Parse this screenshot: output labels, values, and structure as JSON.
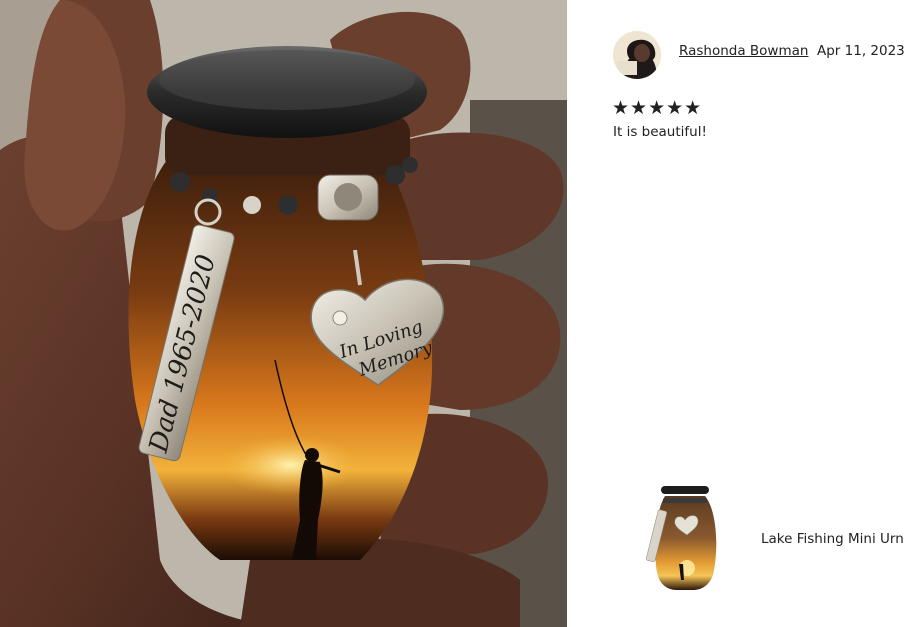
{
  "review": {
    "reviewer_name": "Rashonda Bowman",
    "date": "Apr 11, 2023",
    "rating": 5,
    "stars_text": "★★★★★",
    "text": "It is beautiful!"
  },
  "product": {
    "name": "Lake Fishing Mini Urn"
  },
  "photo": {
    "tag_text": "Dad 1965-2020",
    "charm_line1": "In Loving",
    "charm_line2": "Memory"
  }
}
